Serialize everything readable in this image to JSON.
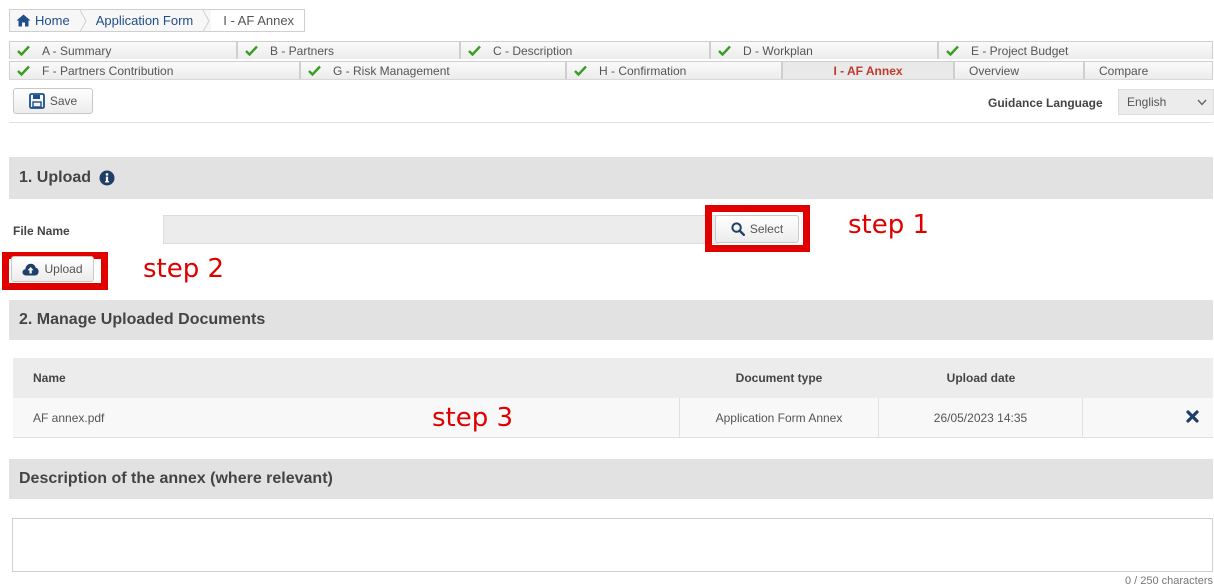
{
  "breadcrumb": {
    "home": "Home",
    "items": [
      "Application Form",
      "I - AF Annex"
    ]
  },
  "tabs": {
    "row1": [
      {
        "label": "A - Summary",
        "checked": true
      },
      {
        "label": "B - Partners",
        "checked": true
      },
      {
        "label": "C - Description",
        "checked": true
      },
      {
        "label": "D - Workplan",
        "checked": true
      },
      {
        "label": "E - Project Budget",
        "checked": true
      }
    ],
    "row2": [
      {
        "label": "F - Partners Contribution",
        "checked": true
      },
      {
        "label": "G - Risk Management",
        "checked": true
      },
      {
        "label": "H - Confirmation",
        "checked": true
      },
      {
        "label": "I - AF Annex",
        "checked": false,
        "active": true
      },
      {
        "label": "Overview",
        "checked": false
      },
      {
        "label": "Compare",
        "checked": false
      }
    ]
  },
  "toolbar": {
    "save_label": "Save",
    "guidance_label": "Guidance Language",
    "language": "English"
  },
  "upload_section": {
    "title": "1. Upload",
    "file_label": "File Name",
    "file_value": "",
    "select_label": "Select",
    "upload_label": "Upload"
  },
  "annotations": {
    "step1": "step 1",
    "step2": "step 2",
    "step3": "step 3"
  },
  "manage_section": {
    "title": "2. Manage Uploaded Documents",
    "columns": [
      "Name",
      "Document type",
      "Upload date"
    ],
    "rows": [
      {
        "name": "AF annex.pdf",
        "type": "Application Form Annex",
        "date": "26/05/2023 14:35"
      }
    ]
  },
  "description_section": {
    "title": "Description of the annex (where relevant)",
    "value": "",
    "char_count": "0 / 250 characters"
  },
  "colors": {
    "accent_red": "#e00000",
    "check_green": "#3a9d23",
    "link_blue": "#1f4e8c",
    "active_tab": "#c0392b"
  }
}
